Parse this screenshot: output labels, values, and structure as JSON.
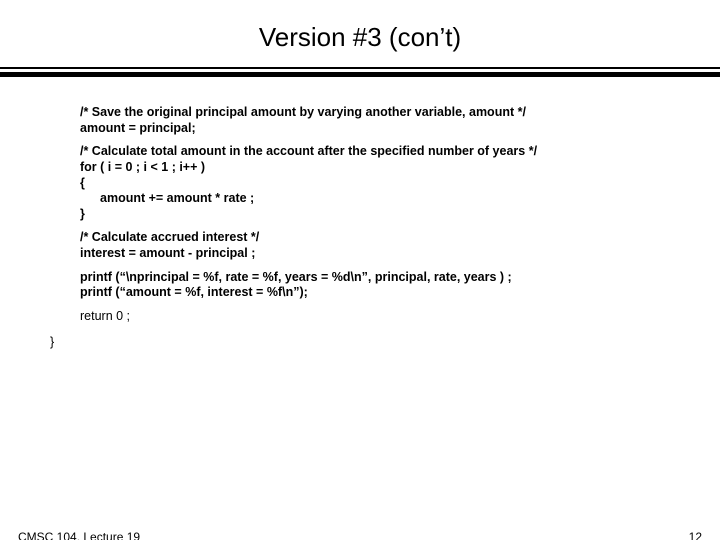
{
  "title": "Version #3 (con’t)",
  "code": {
    "c1_l1": "/* Save the original principal amount by varying another variable, amount */",
    "c1_l2": "amount = principal;",
    "c2_l1": "/* Calculate total amount in the account after the specified number of years */",
    "c2_l2": "for  ( i = 0 ;  i < 1 ;  i++ )",
    "c2_l3": "{",
    "c2_l4": "amount  +=  amount  * rate ;",
    "c2_l5": "}",
    "c3_l1": "/* Calculate accrued interest */",
    "c3_l2": "interest  =  amount  - principal ;",
    "c4_l1": "printf (“\\nprincipal = %f,  rate = %f,  years = %d\\n”,  principal, rate, years ) ;",
    "c4_l2": "printf (“amount = %f,  interest = %f\\n”);",
    "c5_l1": "return 0 ;",
    "close": "}"
  },
  "footer": {
    "left": "CMSC 104, Lecture 19",
    "right": "12"
  }
}
